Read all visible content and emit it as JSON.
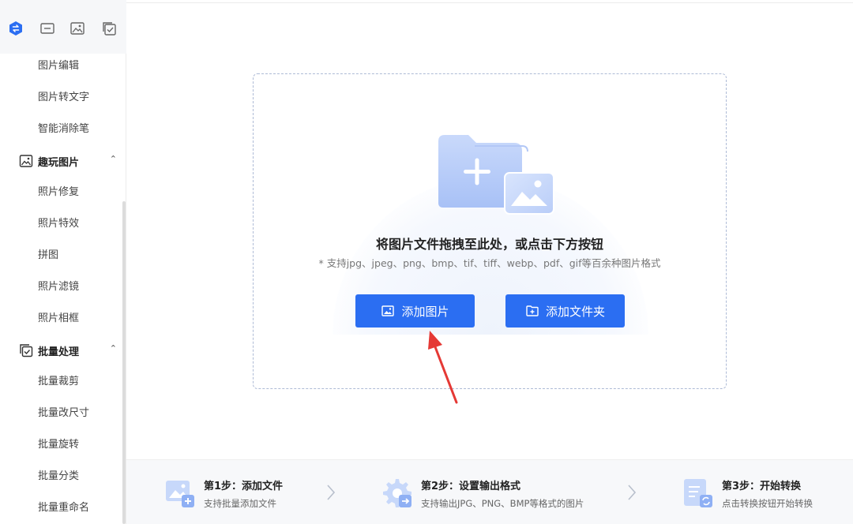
{
  "sidebar": {
    "top_icons": [
      "convert-icon",
      "crop-frame-icon",
      "image-edit-icon",
      "batch-check-icon"
    ],
    "items_top": [
      {
        "label": "图片编辑"
      },
      {
        "label": "图片转文字"
      },
      {
        "label": "智能消除笔"
      }
    ],
    "section_fun": {
      "title": "趣玩图片",
      "items": [
        {
          "label": "照片修复"
        },
        {
          "label": "照片特效"
        },
        {
          "label": "拼图"
        },
        {
          "label": "照片滤镜"
        },
        {
          "label": "照片相框"
        }
      ]
    },
    "section_batch": {
      "title": "批量处理",
      "items": [
        {
          "label": "批量裁剪"
        },
        {
          "label": "批量改尺寸"
        },
        {
          "label": "批量旋转"
        },
        {
          "label": "批量分类"
        },
        {
          "label": "批量重命名"
        }
      ]
    }
  },
  "dropzone": {
    "title": "将图片文件拖拽至此处，或点击下方按钮",
    "subtitle": "* 支持jpg、jpeg、png、bmp、tif、tiff、webp、pdf、gif等百余种图片格式",
    "add_image_label": "添加图片",
    "add_folder_label": "添加文件夹"
  },
  "steps": [
    {
      "title": "第1步：添加文件",
      "desc": "支持批量添加文件"
    },
    {
      "title": "第2步：设置输出格式",
      "desc": "支持输出JPG、PNG、BMP等格式的图片"
    },
    {
      "title": "第3步：开始转换",
      "desc": "点击转换按钮开始转换"
    }
  ],
  "colors": {
    "accent": "#2b6ef2",
    "annotation_arrow": "#e53935"
  }
}
